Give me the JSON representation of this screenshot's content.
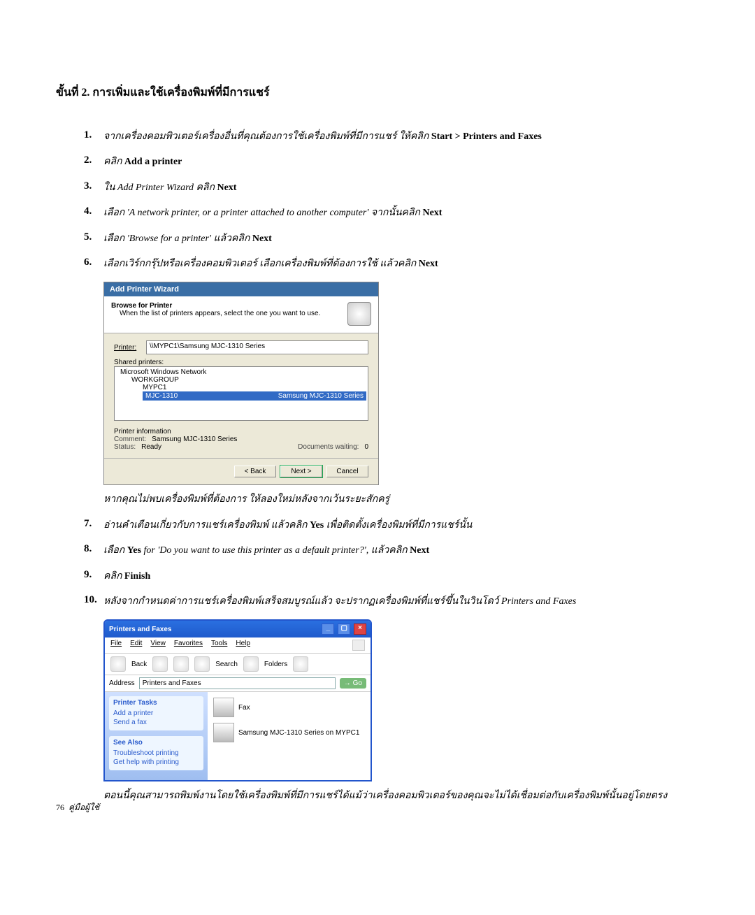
{
  "section_heading": "ขั้นที่ 2. การเพิ่มและใช้เครื่องพิมพ์ที่มีการแชร์",
  "steps": [
    {
      "n": "1.",
      "text_a": "จากเครื่องคอมพิวเตอร์เครื่องอื่นที่คุณต้องการใช้เครื่องพิมพ์ที่มีการแชร์ ให้คลิก ",
      "bold": "Start > Printers and Faxes",
      "text_b": ""
    },
    {
      "n": "2.",
      "text_a": "คลิก ",
      "bold": "Add a printer",
      "text_b": ""
    },
    {
      "n": "3.",
      "text_a": "ใน Add Printer Wizard คลิก ",
      "bold": "Next",
      "text_b": ""
    },
    {
      "n": "4.",
      "text_a": "เลือก 'A network printer, or a printer attached to another computer' จากนั้นคลิก ",
      "bold": "Next",
      "text_b": ""
    },
    {
      "n": "5.",
      "text_a": "เลือก 'Browse for a printer' แล้วคลิก ",
      "bold": "Next",
      "text_b": ""
    },
    {
      "n": "6.",
      "text_a": "เลือกเวิร์กกรุ๊ปหรือเครื่องคอมพิวเตอร์ เลือกเครื่องพิมพ์ที่ต้องการใช้ แล้วคลิก ",
      "bold": "Next",
      "text_b": ""
    }
  ],
  "note_step6": "หากคุณไม่พบเครื่องพิมพ์ที่ต้องการ ให้ลองใหม่หลังจากเว้นระยะสักครู่",
  "steps2": [
    {
      "n": "7.",
      "text_a": "อ่านคำเตือนเกี่ยวกับการแชร์เครื่องพิมพ์ แล้วคลิก ",
      "bold": "Yes",
      "text_b": " เพื่อติดตั้งเครื่องพิมพ์ที่มีการแชร์นั้น"
    },
    {
      "n": "8.",
      "text_a": "เลือก ",
      "bold": "Yes",
      "text_b": " for 'Do you want to use this printer as a default printer?', แล้วคลิก ",
      "bold2": "Next"
    },
    {
      "n": "9.",
      "text_a": "คลิก ",
      "bold": "Finish",
      "text_b": ""
    },
    {
      "n": "10.",
      "text_a": "หลังจากกำหนดค่าการแชร์เครื่องพิมพ์เสร็จสมบูรณ์แล้ว จะปรากฏเครื่องพิมพ์ที่แชร์ขึ้นในวินโดว์ Printers and Faxes",
      "bold": "",
      "text_b": ""
    }
  ],
  "closing": "ตอนนี้คุณสามารถพิมพ์งานโดยใช้เครื่องพิมพ์ที่มีการแชร์ได้แม้ว่าเครื่องคอมพิวเตอร์ของคุณจะไม่ได้เชื่อมต่อกับเครื่องพิมพ์นั้นอยู่โดยตรง",
  "dlg": {
    "title": "Add Printer Wizard",
    "browse": "Browse for Printer",
    "sub": "When the list of printers appears, select the one you want to use.",
    "printer_label": "Printer:",
    "printer_value": "\\\\MYPC1\\Samsung MJC-1310 Series",
    "shared_label": "Shared printers:",
    "tree_root": "Microsoft Windows Network",
    "tree_wg": "WORKGROUP",
    "tree_pc": "MYPC1",
    "tree_sel": "MJC-1310",
    "tree_sel_right": "Samsung MJC-1310 Series",
    "info_head": "Printer information",
    "comment_label": "Comment:",
    "comment_value": "Samsung MJC-1310 Series",
    "status_label": "Status:",
    "status_value": "Ready",
    "docs_label": "Documents waiting:",
    "docs_value": "0",
    "back": "< Back",
    "next": "Next >",
    "cancel": "Cancel"
  },
  "win": {
    "title": "Printers and Faxes",
    "menu": {
      "file": "File",
      "edit": "Edit",
      "view": "View",
      "fav": "Favorites",
      "tools": "Tools",
      "help": "Help"
    },
    "toolbar": {
      "back": "Back",
      "search": "Search",
      "folders": "Folders"
    },
    "addr_label": "Address",
    "addr_value": "Printers and Faxes",
    "go": "Go",
    "tasks_head": "Printer Tasks",
    "task_add": "Add a printer",
    "task_fax": "Send a fax",
    "see_also_head": "See Also",
    "see_trouble": "Troubleshoot printing",
    "see_help": "Get help with printing",
    "fax_item": "Fax",
    "shared_item": "Samsung MJC-1310 Series on MYPC1"
  },
  "footer_page": "76",
  "footer_label": "คู่มือผู้ใช้"
}
